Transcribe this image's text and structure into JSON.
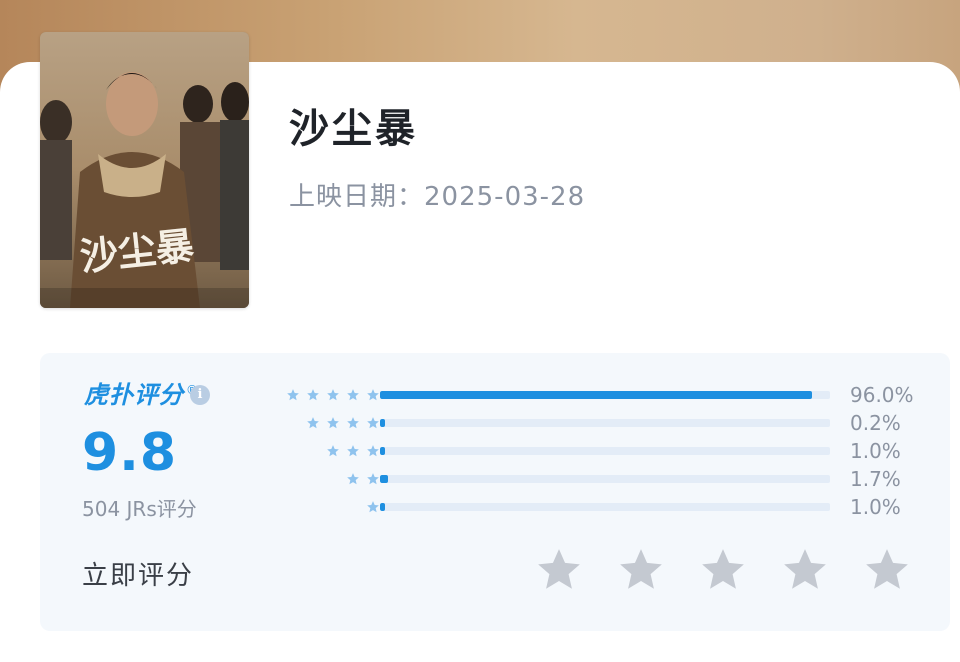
{
  "movie": {
    "title": "沙尘暴",
    "release_label": "上映日期：",
    "release_date": "2025-03-28",
    "poster": {
      "title_art": "沙尘暴",
      "icon": "movie-poster"
    }
  },
  "rating": {
    "brand": "虎扑评分",
    "brand_mark": "®",
    "info_icon": "info-icon",
    "score": "9.8",
    "votes": "504 JRs评分",
    "distribution": [
      {
        "stars": 5,
        "percent_label": "96.0%",
        "percent": 96.0
      },
      {
        "stars": 4,
        "percent_label": "0.2%",
        "percent": 0.2
      },
      {
        "stars": 3,
        "percent_label": "1.0%",
        "percent": 1.0
      },
      {
        "stars": 2,
        "percent_label": "1.7%",
        "percent": 1.7
      },
      {
        "stars": 1,
        "percent_label": "1.0%",
        "percent": 1.0
      }
    ],
    "rate_now_label": "立即评分",
    "rate_star_count": 5
  },
  "colors": {
    "accent": "#1e8fe0",
    "bar_track": "#e3ecf7",
    "small_star": "#8fc3ee",
    "rate_star": "#c4c9d1",
    "muted_text": "#8b93a1"
  }
}
